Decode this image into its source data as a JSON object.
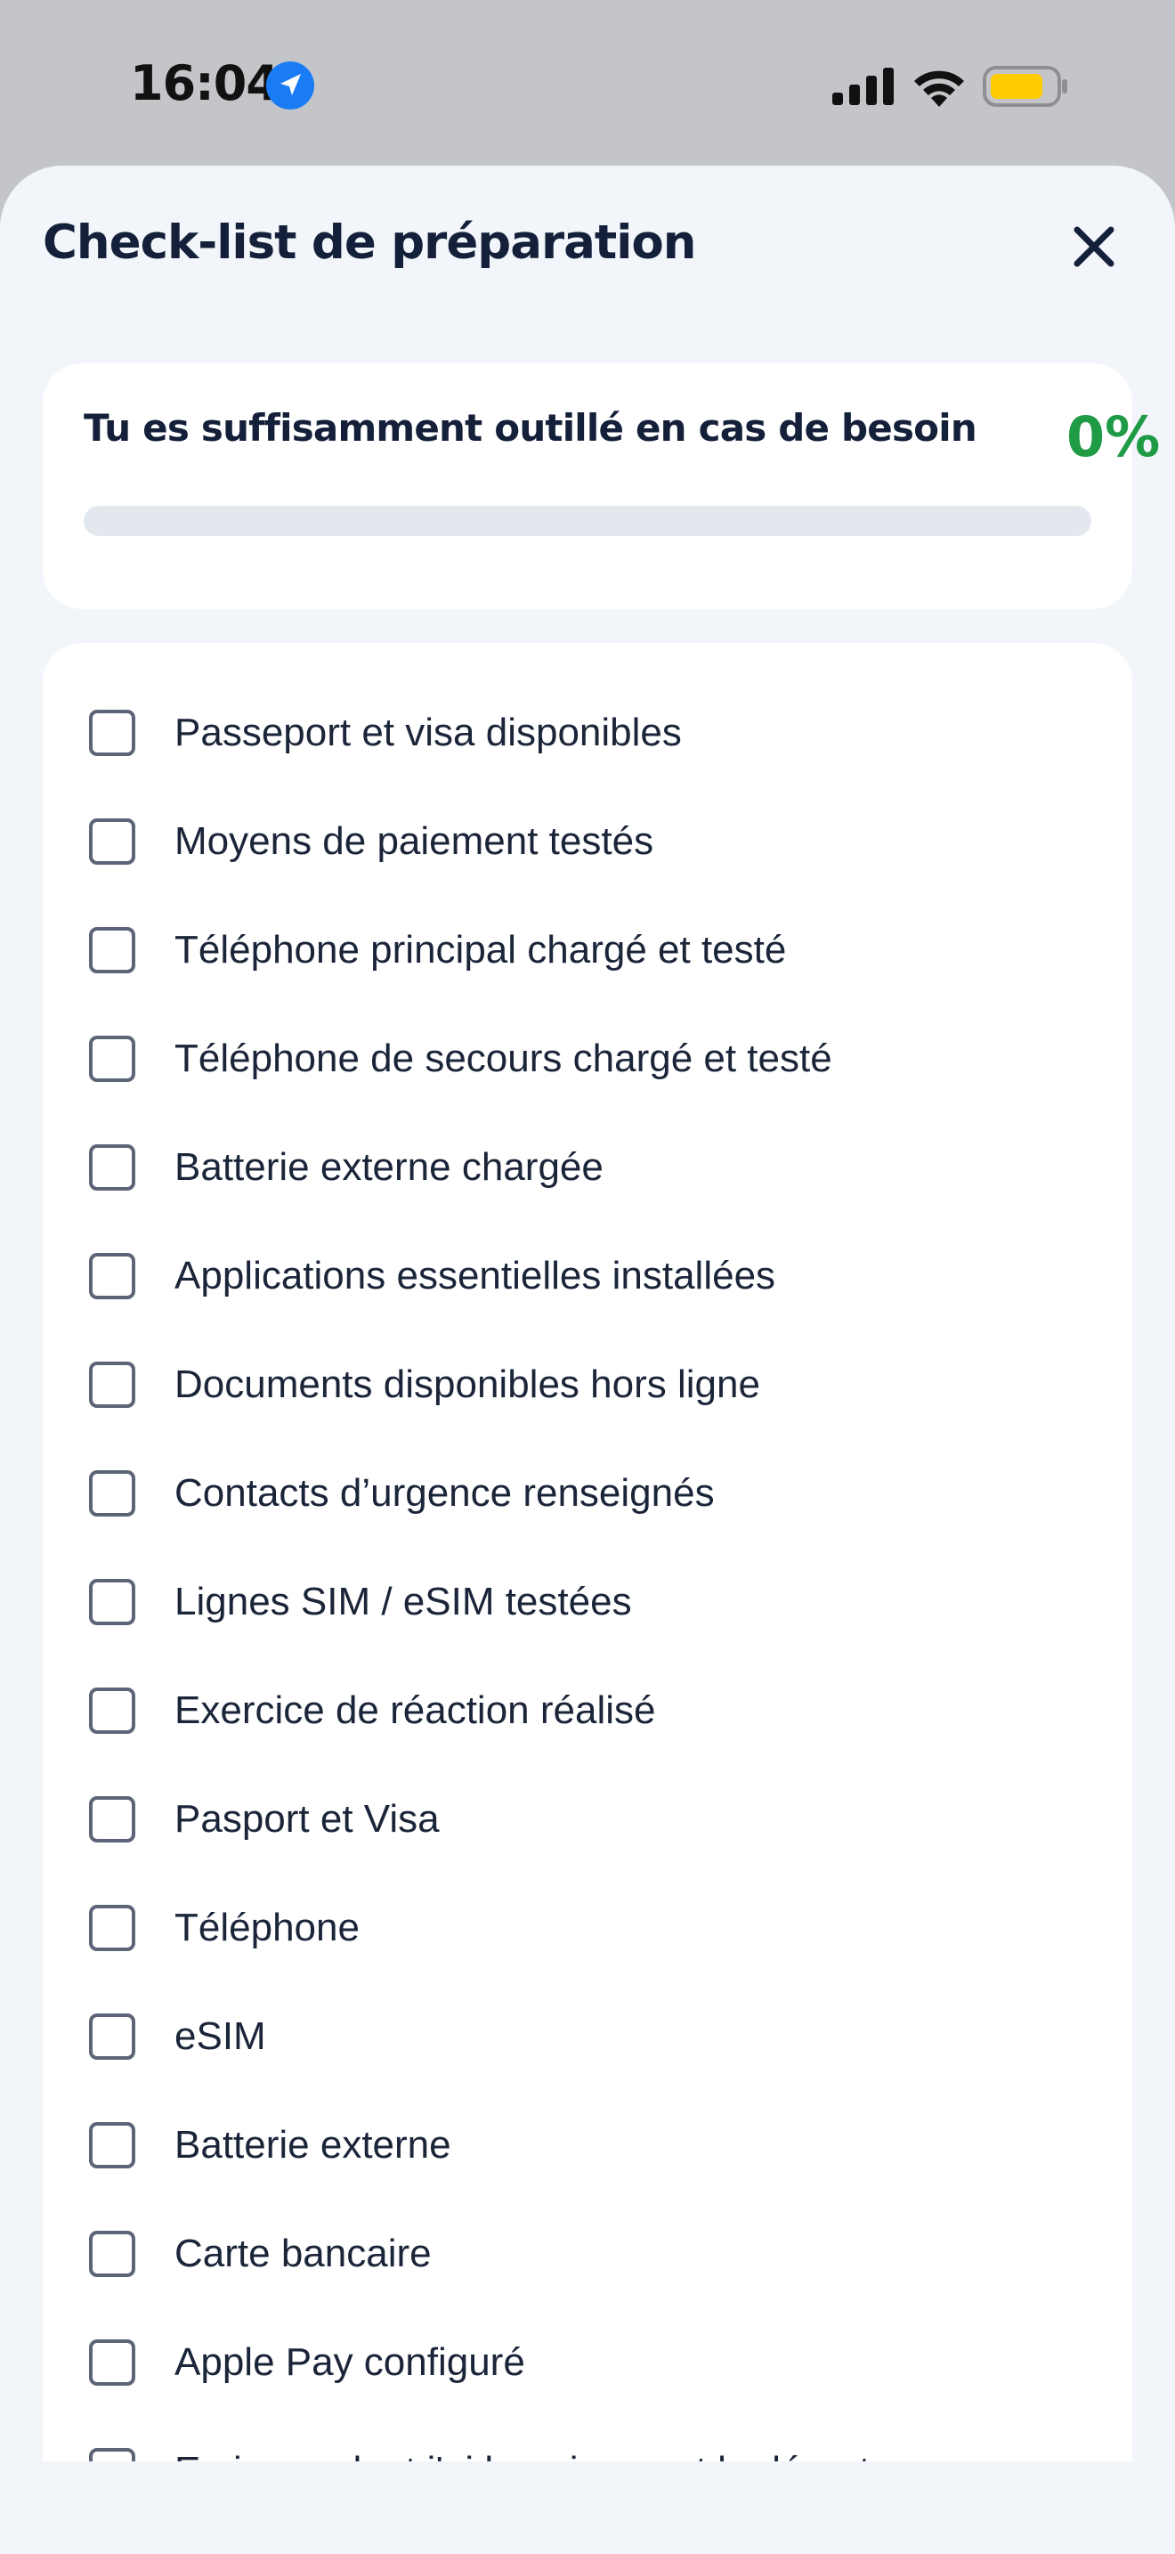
{
  "status_bar": {
    "time": "16:04",
    "icons": [
      "location-arrow-icon",
      "cellular-signal-icon",
      "wifi-icon",
      "battery-icon"
    ],
    "battery_color": "#ffcc00"
  },
  "sheet": {
    "title": "Check-list de préparation",
    "close_icon": "close-icon"
  },
  "progress": {
    "label": "Tu es suffisamment outillé en cas de besoin",
    "percent_text": "0%",
    "value": 0,
    "accent_color": "#1f9a45"
  },
  "checklist": {
    "items": [
      {
        "label": "Passeport et visa disponibles",
        "checked": false
      },
      {
        "label": "Moyens de paiement testés",
        "checked": false
      },
      {
        "label": "Téléphone principal chargé et testé",
        "checked": false
      },
      {
        "label": "Téléphone de secours chargé et testé",
        "checked": false
      },
      {
        "label": "Batterie externe chargée",
        "checked": false
      },
      {
        "label": "Applications essentielles installées",
        "checked": false
      },
      {
        "label": "Documents disponibles hors ligne",
        "checked": false
      },
      {
        "label": "Contacts d’urgence renseignés",
        "checked": false
      },
      {
        "label": "Lignes SIM / eSIM testées",
        "checked": false
      },
      {
        "label": "Exercice de réaction réalisé",
        "checked": false
      },
      {
        "label": "Pasport et Visa",
        "checked": false
      },
      {
        "label": "Téléphone",
        "checked": false
      },
      {
        "label": "eSIM",
        "checked": false
      },
      {
        "label": "Batterie externe",
        "checked": false
      },
      {
        "label": "Carte bancaire",
        "checked": false
      },
      {
        "label": "Apple Pay configuré",
        "checked": false
      },
      {
        "label": "Ecrire ce dont j'ai besoin avant le départ",
        "checked": false
      }
    ]
  }
}
